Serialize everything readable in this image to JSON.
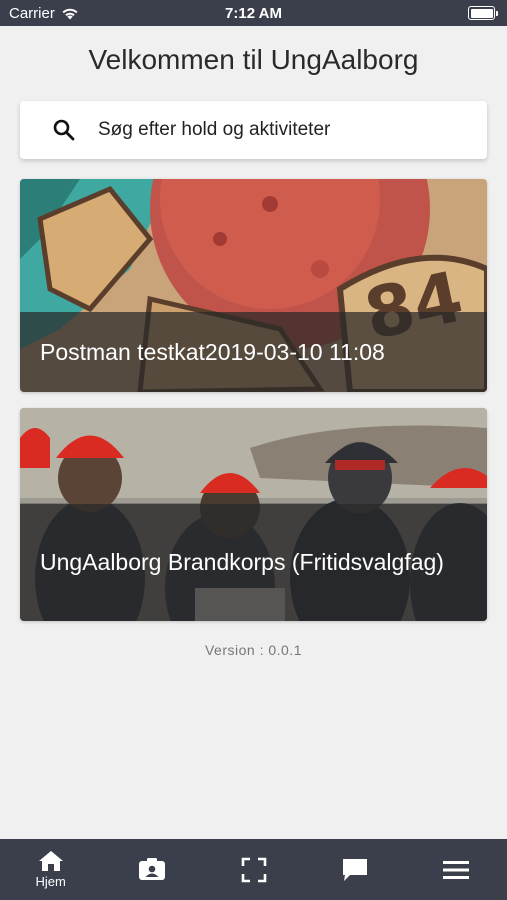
{
  "status_bar": {
    "carrier": "Carrier",
    "time": "7:12 AM"
  },
  "header": {
    "title": "Velkommen til UngAalborg"
  },
  "search": {
    "placeholder": "Søg efter hold og aktiviteter"
  },
  "cards": [
    {
      "title": "Postman testkat2019-03-10 11:08",
      "image": "graffiti-artwork-image"
    },
    {
      "title": "UngAalborg Brandkorps (Fritidsvalgfag)",
      "image": "firefighters-helmets-image"
    }
  ],
  "footer": {
    "version": "Version : 0.0.1"
  },
  "tab_bar": {
    "items": [
      {
        "label": "Hjem",
        "icon": "home-icon",
        "active": true
      },
      {
        "label": "",
        "icon": "contact-card-icon"
      },
      {
        "label": "",
        "icon": "scan-frame-icon"
      },
      {
        "label": "",
        "icon": "chat-bubble-icon"
      },
      {
        "label": "",
        "icon": "menu-icon"
      }
    ]
  },
  "colors": {
    "bar": "#3b3f4c",
    "background": "#f0f0f0"
  }
}
